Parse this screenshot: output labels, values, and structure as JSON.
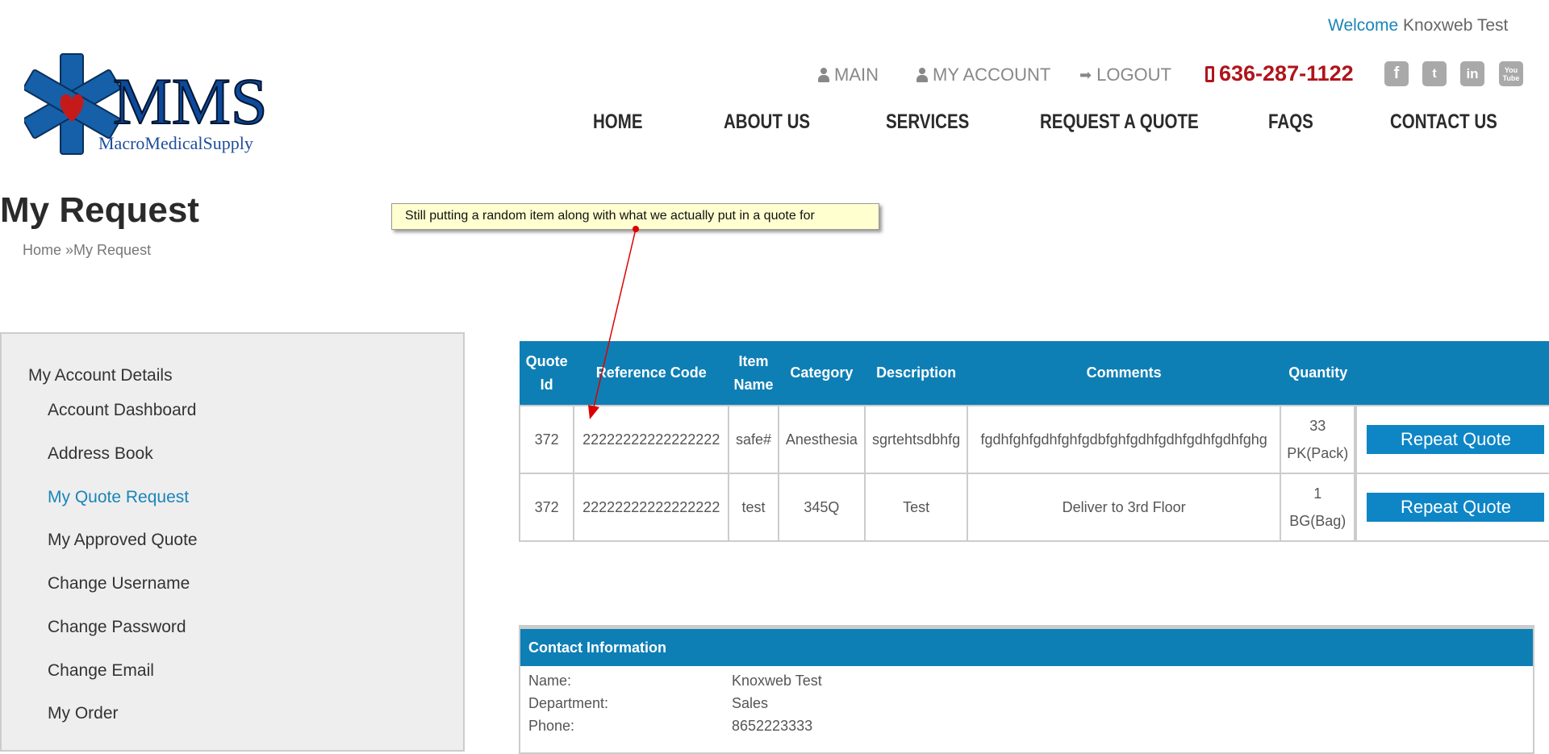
{
  "header": {
    "welcome_label": "Welcome",
    "user_name": "Knoxweb Test",
    "top_links": {
      "main": "MAIN",
      "account": "MY ACCOUNT",
      "logout": "LOGOUT"
    },
    "phone": "636-287-1122",
    "social": [
      "facebook-icon",
      "twitter-icon",
      "linkedin-icon",
      "youtube-icon"
    ],
    "logo_text": "MMS",
    "logo_sub": "MacroMedicalSupply",
    "nav": [
      "HOME",
      "ABOUT US",
      "SERVICES",
      "REQUEST A QUOTE",
      "FAQS",
      "CONTACT US"
    ]
  },
  "page": {
    "title": "My Request",
    "breadcrumb_home": "Home",
    "breadcrumb_sep": " »",
    "breadcrumb_current": "My Request"
  },
  "annotation": {
    "text": "Still putting a random item along with what we actually put in a quote for",
    "color": "#ffffd0"
  },
  "sidebar": {
    "heading": "My Account Details",
    "items": [
      "Account Dashboard",
      "Address Book",
      "My Quote Request",
      "My Approved Quote",
      "Change Username",
      "Change Password",
      "Change Email",
      "My Order"
    ],
    "active": "My Quote Request"
  },
  "table": {
    "headers": [
      "Quote Id",
      "Reference Code",
      "Item Name",
      "Category",
      "Description",
      "Comments",
      "Quantity"
    ],
    "rows": [
      {
        "quote_id": "372",
        "ref": "22222222222222222",
        "item": "safe#",
        "category": "Anesthesia",
        "description": "sgrtehtsdbhfg",
        "comments": "fgdhfghfgdhfghfgdbfghfgdhfgdhfgdhfgdhfghg",
        "qty": "33",
        "unit": "PK(Pack)",
        "button": "Repeat Quote"
      },
      {
        "quote_id": "372",
        "ref": "22222222222222222",
        "item": "test",
        "category": "345Q",
        "description": "Test",
        "comments": "Deliver to 3rd Floor",
        "qty": "1",
        "unit": "BG(Bag)",
        "button": "Repeat Quote"
      }
    ]
  },
  "contact": {
    "heading": "Contact Information",
    "rows": [
      {
        "label": "Name:",
        "value": "Knoxweb Test"
      },
      {
        "label": "Department:",
        "value": "Sales"
      },
      {
        "label": "Phone:",
        "value": "8652223333"
      }
    ]
  },
  "colors": {
    "accent": "#0e7fb5",
    "phone": "#b0141b",
    "link": "#1a85b9"
  }
}
